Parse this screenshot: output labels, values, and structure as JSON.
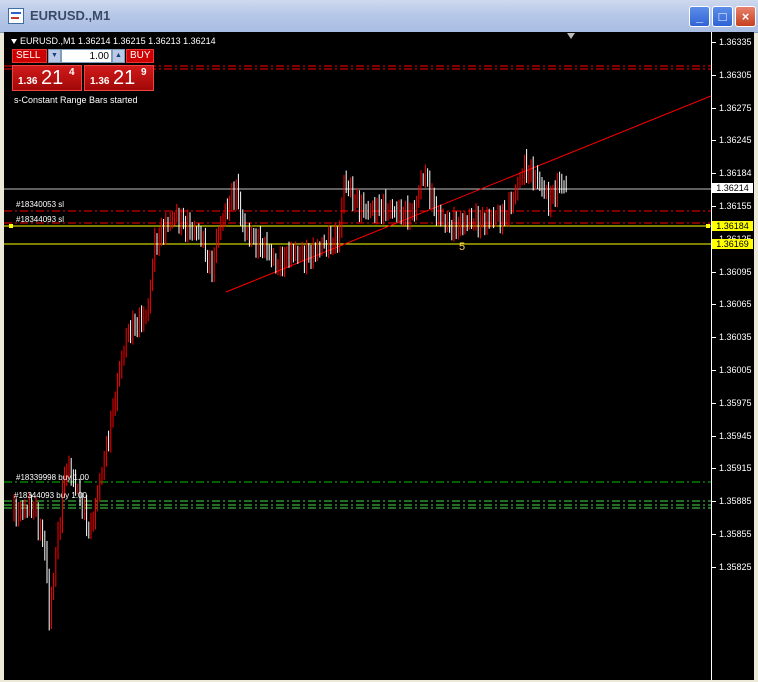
{
  "window": {
    "title": "EURUSD.,M1"
  },
  "title_buttons": {
    "minimize": "_",
    "maximize": "□",
    "close": "×"
  },
  "chart_header": {
    "symbol_line": "EURUSD.,M1  1.36214 1.36215 1.36213 1.36214"
  },
  "trade_panel": {
    "sell_label": "SELL",
    "buy_label": "BUY",
    "lot_value": "1.00",
    "sell_quote": {
      "prefix": "1.36",
      "big": "21",
      "sup": "4"
    },
    "buy_quote": {
      "prefix": "1.36",
      "big": "21",
      "sup": "9"
    }
  },
  "status_message": "s-Constant Range Bars started",
  "order_labels": [
    {
      "text": "#18340053 sl"
    },
    {
      "text": "#18344093 sl"
    },
    {
      "text": "#18339998 buy 1.00"
    },
    {
      "text": "#18344093 buy 1.00"
    }
  ],
  "bar_number": "5",
  "price_axis": {
    "ticks": [
      "1.36335",
      "1.36305",
      "1.36275",
      "1.36245",
      "1.36184",
      "1.36155",
      "1.36125",
      "1.36095",
      "1.36065",
      "1.36035",
      "1.36005",
      "1.35975",
      "1.35945",
      "1.35915",
      "1.35885",
      "1.35855",
      "1.35825"
    ],
    "current_price": "1.36214",
    "level_1": "1.36184",
    "level_2": "1.36169"
  },
  "colors": {
    "background": "#000000",
    "bull_bar": "#ff0000",
    "bear_bar": "#ffffff",
    "bid_line": "#c0c0c0",
    "sl_line": "#ff0000",
    "buy_line": "#00c000",
    "level_line": "#ffff00",
    "trendline": "#ff0000"
  }
}
